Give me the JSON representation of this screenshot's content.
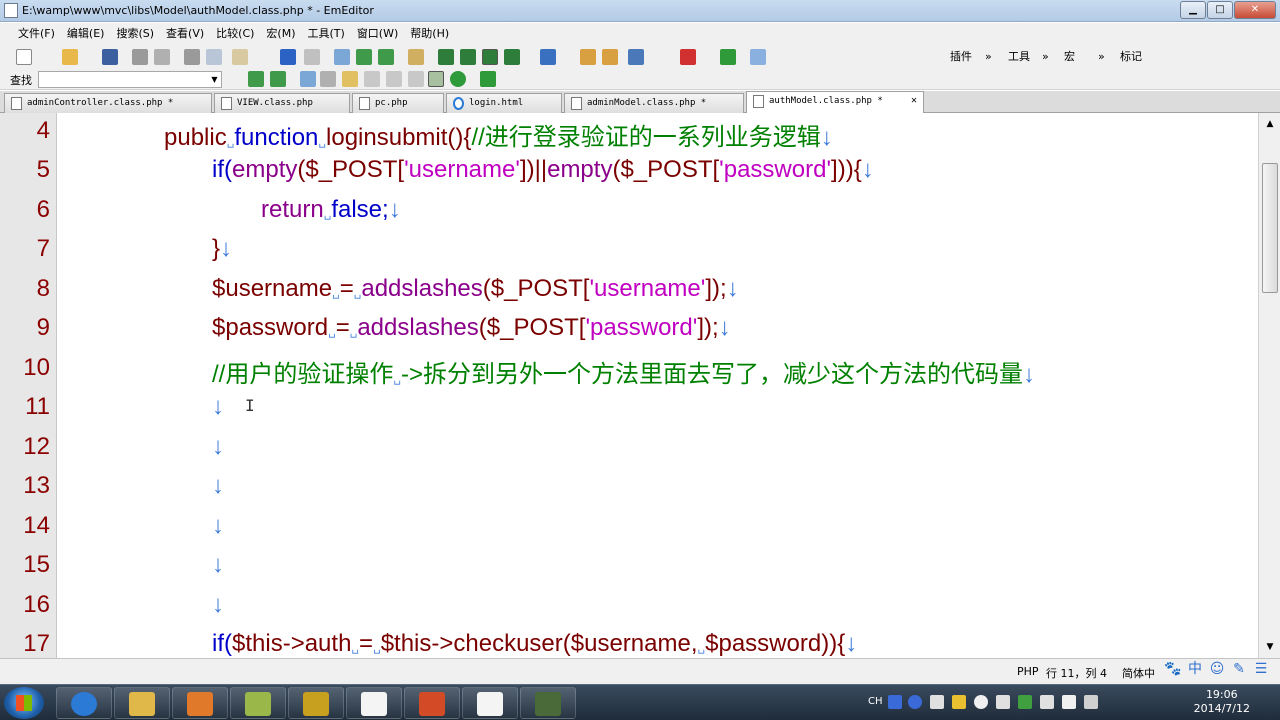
{
  "window": {
    "title": "E:\\wamp\\www\\mvc\\libs\\Model\\authModel.class.php * - EmEditor",
    "minimize": "▁",
    "maximize": "□",
    "close": "✕"
  },
  "menu": [
    "文件(F)",
    "编辑(E)",
    "搜索(S)",
    "查看(V)",
    "比较(C)",
    "宏(M)",
    "工具(T)",
    "窗口(W)",
    "帮助(H)"
  ],
  "toolbar": {
    "plugins": "插件",
    "tools": "工具",
    "macro": "宏",
    "bookmark": "标记",
    "chevron": "»"
  },
  "find": {
    "label": "查找",
    "value": ""
  },
  "tabs": [
    {
      "label": "adminController.class.php *",
      "active": false,
      "icon": "file-icon"
    },
    {
      "label": "VIEW.class.php",
      "active": false,
      "icon": "file-icon"
    },
    {
      "label": "pc.php",
      "active": false,
      "icon": "file-icon"
    },
    {
      "label": "login.html",
      "active": false,
      "icon": "ie-icon"
    },
    {
      "label": "adminModel.class.php *",
      "active": false,
      "icon": "file-icon"
    },
    {
      "label": "authModel.class.php *",
      "active": true,
      "icon": "file-icon"
    }
  ],
  "tab_close": "✕",
  "editor": {
    "line_numbers": [
      "4",
      "5",
      "6",
      "7",
      "8",
      "9",
      "10",
      "11",
      "12",
      "13",
      "14",
      "15",
      "16",
      "17"
    ],
    "marks": {
      "newline": "↓",
      "space": "␣"
    },
    "code": {
      "l4": {
        "kw1": "public",
        "kw2": "function",
        "name": "loginsubmit(){",
        "cmt": "//进行登录验证的一系列业务逻辑"
      },
      "l5": {
        "kw": "if(",
        "fn1": "empty",
        "p1": "($_POST[",
        "s1": "'username'",
        "p2": "])||",
        "fn2": "empty",
        "p3": "($_POST[",
        "s2": "'password'",
        "p4": "])){"
      },
      "l6": {
        "kw1": "return",
        "kw2": "false;"
      },
      "l7": {
        "p": "}"
      },
      "l8": {
        "v": "$username",
        "eq": "=",
        "fn": "addslashes",
        "p1": "($_POST[",
        "s": "'username'",
        "p2": "]);"
      },
      "l9": {
        "v": "$password",
        "eq": "=",
        "fn": "addslashes",
        "p1": "($_POST[",
        "s": "'password'",
        "p2": "]);"
      },
      "l10": {
        "c1": "//用户的验证操作",
        "c2": "->拆分到另外一个方法里面去写了，减少这个方法的代码量"
      },
      "l17": {
        "kw": "if(",
        "p1": "$this->auth",
        "eq": "=",
        "p2": "$this->checkuser($username,",
        "p3": "$password)){"
      }
    }
  },
  "status": {
    "language": "PHP",
    "position": "行 11，列 4",
    "encoding": "简体中"
  },
  "ime_icons": [
    "🐾",
    "中",
    "☺",
    "✎",
    "☰"
  ],
  "taskbar": {
    "tray_lang": "CH",
    "time": "19:06",
    "date": "2014/7/12"
  }
}
